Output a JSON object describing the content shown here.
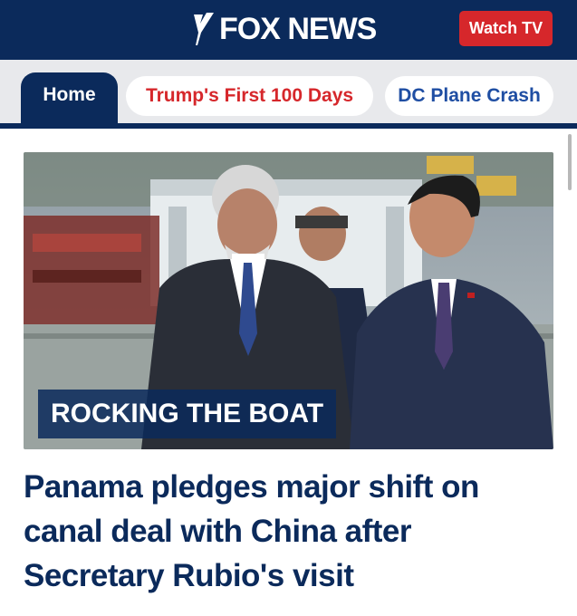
{
  "header": {
    "logo_text": "FOX NEWS",
    "watch_label": "Watch TV",
    "bg_color": "#0b2a5b",
    "accent_color": "#d6272b"
  },
  "nav": {
    "tabs": [
      {
        "label": "Home",
        "active": true
      },
      {
        "label": "Trump's First 100 Days",
        "active": false
      },
      {
        "label": "DC Plane Crash",
        "active": false
      }
    ]
  },
  "story": {
    "kicker": "ROCKING THE BOAT",
    "headline": "Panama pledges major shift on canal deal with China after Secretary Rubio's visit"
  },
  "icons": {
    "logo_mark": "fox-slash-logo-icon"
  }
}
